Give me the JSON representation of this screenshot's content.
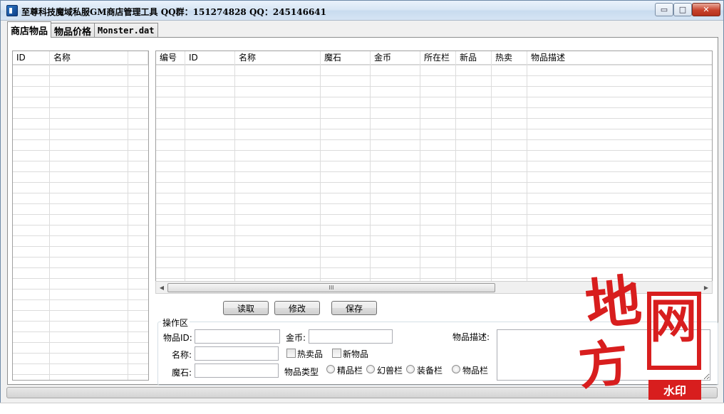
{
  "window": {
    "title": "至尊科技魔域私服GM商店管理工具 QQ群：151274828 QQ：245146641",
    "min_glyph": "▭",
    "max_glyph": "□",
    "close_glyph": "✕"
  },
  "tabs": [
    {
      "label": "商店物品",
      "active": true
    },
    {
      "label": "物品价格",
      "active": false
    },
    {
      "label": "Monster.dat",
      "active": false
    }
  ],
  "left_grid": {
    "columns": [
      "ID",
      "名称",
      ""
    ]
  },
  "main_grid": {
    "columns": [
      "编号",
      "ID",
      "名称",
      "魔石",
      "金币",
      "所在栏",
      "新品",
      "热卖",
      "物品描述"
    ]
  },
  "scrollbar": {
    "left_arrow": "◀",
    "right_arrow": "▶",
    "thumb_grip": "III"
  },
  "buttons": {
    "read": "读取",
    "modify": "修改",
    "save": "保存"
  },
  "operation_area": {
    "legend": "操作区",
    "item_id_label": "物品ID:",
    "name_label": "名称:",
    "magic_stone_label": "魔石:",
    "gold_label": "金币:",
    "hot_item_label": "热卖品",
    "new_item_label": "新物品",
    "item_type_label": "物品类型",
    "radio_options": [
      "精品栏",
      "幻兽栏",
      "装备栏",
      "物品栏"
    ],
    "description_label": "物品描述:",
    "item_id_value": "",
    "name_value": "",
    "magic_stone_value": "",
    "gold_value": "",
    "description_value": ""
  },
  "watermark": {
    "char1": "地",
    "char2": "方",
    "char3": "网",
    "badge": "水印",
    "color": "#d81e1e"
  }
}
